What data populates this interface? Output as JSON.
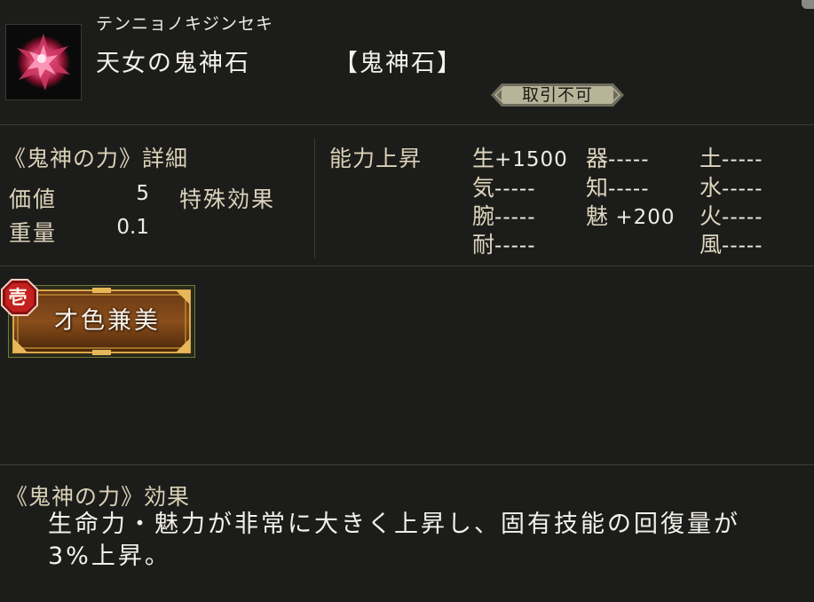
{
  "item": {
    "reading": "テンニョノキジンセキ",
    "name": "天女の鬼神石",
    "type": "【鬼神石】",
    "trade_status": "取引不可",
    "icon": "red-crystal-gem-icon"
  },
  "details": {
    "title": "《鬼神の力》詳細",
    "value_label": "価値",
    "value": "5",
    "special_label": "特殊効果",
    "weight_label": "重量",
    "weight": "0.1"
  },
  "stats": {
    "title": "能力上昇",
    "entries": [
      {
        "key": "生",
        "value": "+1500"
      },
      {
        "key": "気",
        "value": "-----"
      },
      {
        "key": "腕",
        "value": "-----"
      },
      {
        "key": "耐",
        "value": "-----"
      },
      {
        "key": "器",
        "value": "-----"
      },
      {
        "key": "知",
        "value": "-----"
      },
      {
        "key": "魅",
        "value": " +200"
      },
      {
        "key": "土",
        "value": "-----"
      },
      {
        "key": "水",
        "value": "-----"
      },
      {
        "key": "火",
        "value": "-----"
      },
      {
        "key": "風",
        "value": "-----"
      }
    ]
  },
  "skill": {
    "rank": "壱",
    "name": "才色兼美"
  },
  "effect": {
    "title": "《鬼神の力》効果",
    "text": "生命力・魅力が非常に大きく上昇し、固有技能の回復量が3%上昇。"
  },
  "colors": {
    "background": "#1c1d1b",
    "label": "#dcd3bb",
    "badge": "#b8b49a",
    "skill_frame": "#c99a3a",
    "rank_red": "#c42020"
  }
}
